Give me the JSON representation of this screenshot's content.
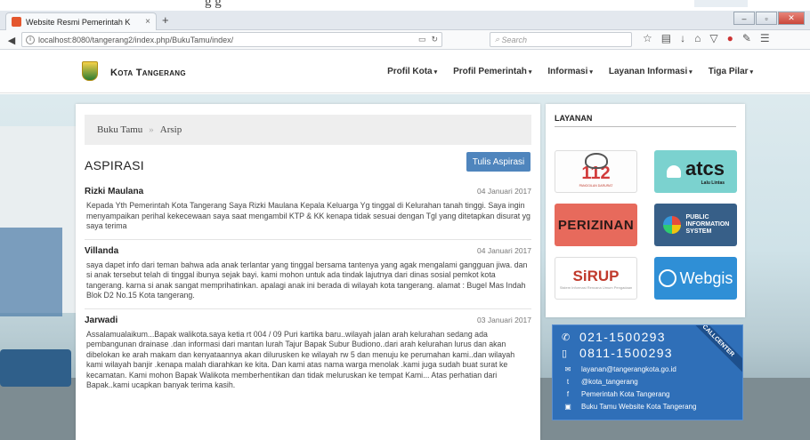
{
  "top_ghost_text": "g g",
  "browser": {
    "tab_title": "Website Resmi Pemerintah K",
    "tab_close": "×",
    "new_tab": "+",
    "url": "localhost:8080/tangerang2/index.php/BukuTamu/index/",
    "search_placeholder": "Search"
  },
  "site": {
    "brand": "Kota Tangerang",
    "menu": [
      "Profil Kota",
      "Profil Pemerintah",
      "Informasi",
      "Layanan Informasi",
      "Tiga Pilar"
    ]
  },
  "breadcrumb": {
    "home": "Buku Tamu",
    "separator": "»",
    "current": "Arsip"
  },
  "section_title": "ASPIRASI",
  "write_button": "Tulis Aspirasi",
  "entries": [
    {
      "name": "Rizki Maulana",
      "date": "04 Januari 2017",
      "text": "Kepada Yth Pemerintah Kota Tangerang Saya Rizki Maulana Kepala Keluarga Yg tinggal di Kelurahan tanah tinggi. Saya ingin menyampaikan perihal kekecewaan saya saat mengambil KTP & KK kenapa tidak sesuai dengan Tgl yang ditetapkan disurat yg saya terima"
    },
    {
      "name": "Villanda",
      "date": "04 Januari 2017",
      "text": "saya dapet info dari teman bahwa ada anak terlantar yang tinggal bersama tantenya yang agak mengalami gangguan jiwa. dan si anak tersebut telah di tinggal ibunya sejak bayi. kami mohon untuk ada tindak lajutnya dari dinas sosial pemkot kota tangerang. karna si anak sangat memprihatinkan. apalagi anak ini berada di wilayah kota tangerang. alamat : Bugel Mas Indah Blok D2 No.15 Kota tangerang."
    },
    {
      "name": "Jarwadi",
      "date": "03 Januari 2017",
      "text": "Assalamualaikum...Bapak walikota.saya ketia rt 004 / 09 Puri kartika baru..wilayah jalan arah kelurahan sedang ada pembangunan drainase .dan informasi dari mantan lurah Tajur Bapak Subur Budiono..dari arah kelurahan lurus dan akan dibelokan ke arah makam dan kenyataannya akan dilurusken ke wilayah rw 5 dan menuju ke perumahan kami..dan wilayah kami wilayah banjir .kenapa malah diarahkan ke kita. Dan kami atas nama warga menolak .kami juga sudah buat surat ke kecamatan. Kami mohon Bapak Walikota memberhentikan dan tidak meluruskan ke tempat Kami... Atas perhatian dari Bapak..kami ucapkan banyak terima kasih."
    }
  ],
  "layanan": {
    "title": "LAYANAN",
    "svc_112": "112",
    "svc_112_sub": "PANGGILAN DARURAT",
    "svc_atcs": "atcs",
    "svc_atcs_sub": "Lalu Lintas",
    "svc_perizinan": "PERIZINAN",
    "svc_pis": "PUBLIC INFORMATION SYSTEM",
    "svc_sirup": "SiRUP",
    "svc_sirup_sub": "Sistem Informasi Rencana Umum Pengadaan",
    "svc_webgis": "Webgis"
  },
  "callcenter": {
    "phone1": "021-1500293",
    "phone2": "0811-1500293",
    "email": "layanan@tangerangkota.go.id",
    "twitter": "@kota_tangerang",
    "facebook": "Pemerintah Kota Tangerang",
    "guestbook": "Buku Tamu Website Kota Tangerang",
    "ribbon": "CALLCENTER"
  }
}
